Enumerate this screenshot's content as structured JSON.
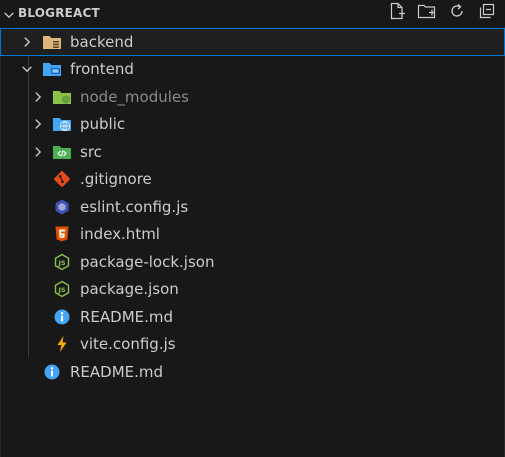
{
  "header": {
    "title": "BLOGREACT",
    "actions": [
      {
        "icon": "new-file-icon"
      },
      {
        "icon": "new-folder-icon"
      },
      {
        "icon": "refresh-icon"
      },
      {
        "icon": "collapse-all-icon"
      }
    ]
  },
  "tree": {
    "items": [
      {
        "label": "backend",
        "type": "folder",
        "expanded": false,
        "icon": "folder-backend-icon",
        "selected": true
      },
      {
        "label": "frontend",
        "type": "folder",
        "expanded": true,
        "icon": "folder-frontend-icon"
      },
      {
        "label": "node_modules",
        "type": "folder",
        "expanded": false,
        "icon": "folder-node-icon",
        "dimmed": true
      },
      {
        "label": "public",
        "type": "folder",
        "expanded": false,
        "icon": "folder-public-icon"
      },
      {
        "label": "src",
        "type": "folder",
        "expanded": false,
        "icon": "folder-src-icon"
      },
      {
        "label": ".gitignore",
        "type": "file",
        "icon": "git-icon"
      },
      {
        "label": "eslint.config.js",
        "type": "file",
        "icon": "eslint-icon"
      },
      {
        "label": "index.html",
        "type": "file",
        "icon": "html5-icon"
      },
      {
        "label": "package-lock.json",
        "type": "file",
        "icon": "nodejs-icon"
      },
      {
        "label": "package.json",
        "type": "file",
        "icon": "nodejs-icon"
      },
      {
        "label": "README.md",
        "type": "file",
        "icon": "info-icon"
      },
      {
        "label": "vite.config.js",
        "type": "file",
        "icon": "vite-icon"
      },
      {
        "label": "README.md",
        "type": "file",
        "icon": "info-icon"
      }
    ]
  },
  "colors": {
    "background": "#181818",
    "text": "#cccccc",
    "dim_text": "#8b8b8b",
    "selection_border": "#0078d4",
    "folder_yellow": "#dcb67a",
    "folder_blue": "#42a5f5",
    "node_green": "#8bc34a",
    "src_green": "#4caf50",
    "git_orange": "#e64a19",
    "eslint_purple": "#3f51b5",
    "html_orange": "#e65100",
    "info_blue": "#42a5f5",
    "vite_yellow": "#ffab00"
  }
}
